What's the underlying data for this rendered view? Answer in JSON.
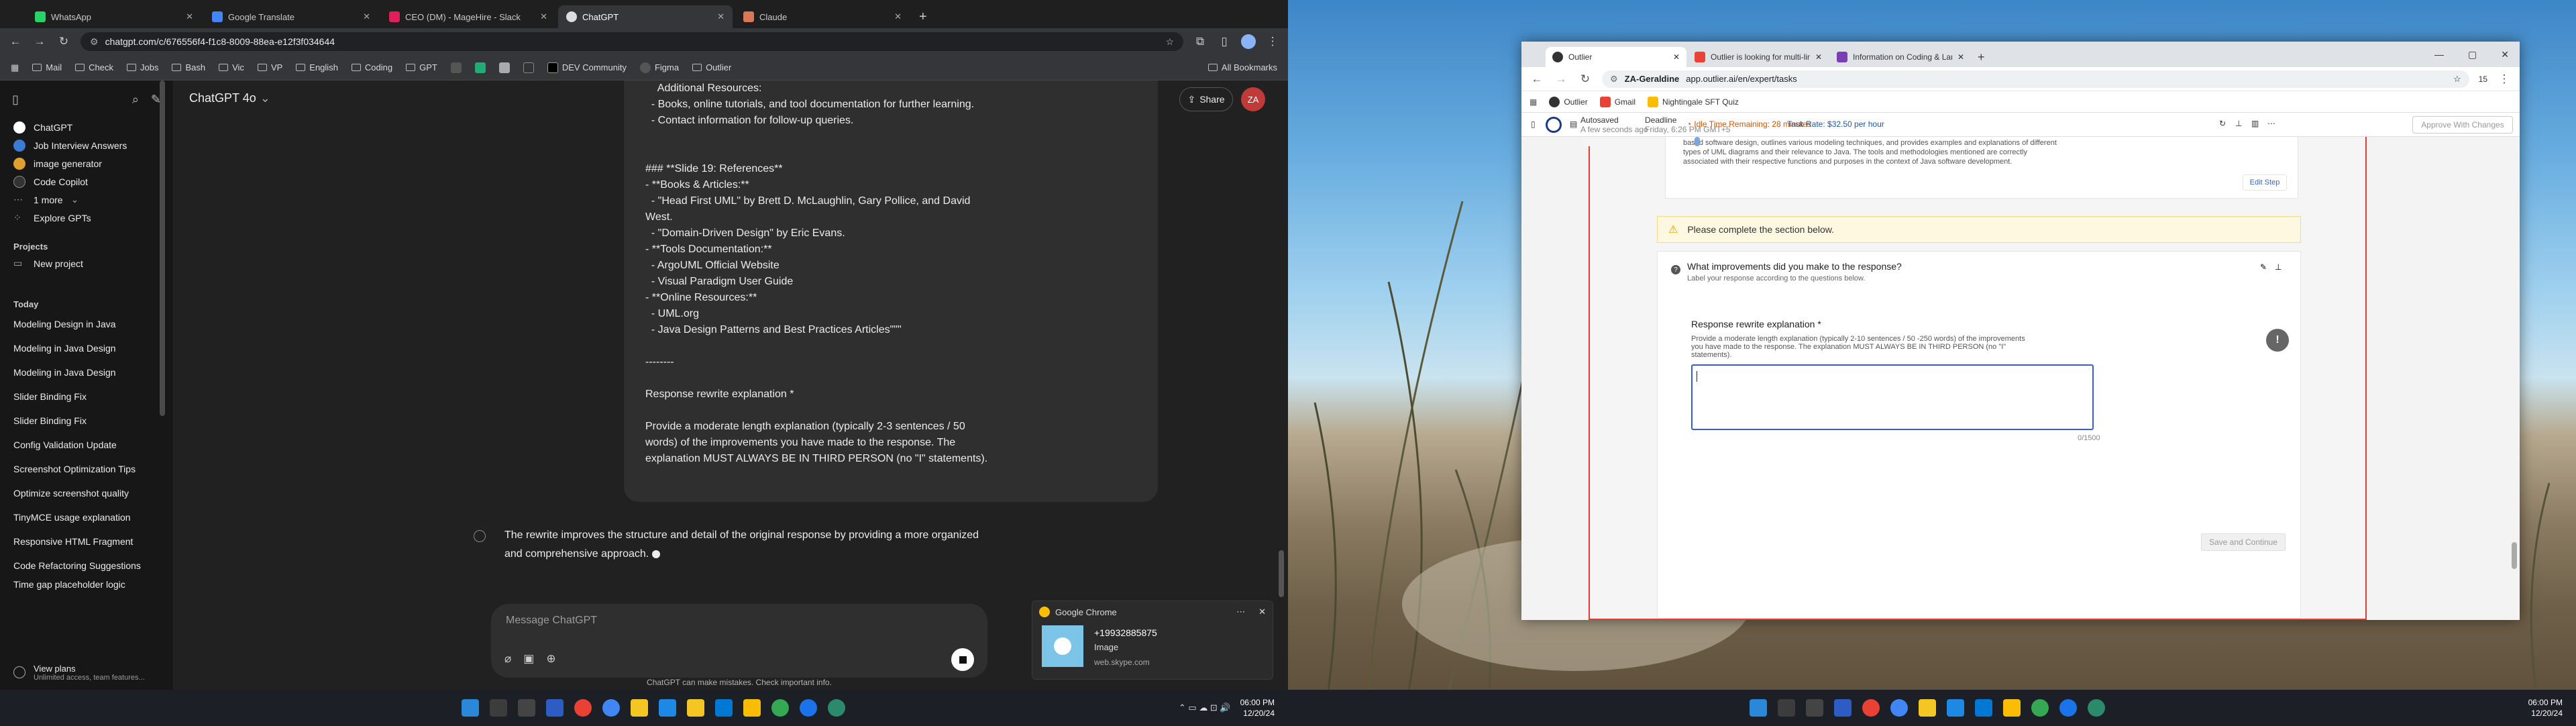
{
  "left_browser": {
    "tabs": [
      {
        "title": "WhatsApp",
        "color": "#25d366"
      },
      {
        "title": "Google Translate",
        "color": "#4285f4"
      },
      {
        "title": "CEO (DM) - MageHire - Slack",
        "color": "#e01e5a"
      },
      {
        "title": "ChatGPT",
        "color": "#dddddd"
      },
      {
        "title": "Claude",
        "color": "#d97757"
      }
    ],
    "url": "chatgpt.com/c/676556f4-f1c8-8009-88ea-e12f3f034644",
    "bookmarks": [
      "Mail",
      "Check",
      "Jobs",
      "Bash",
      "Vic",
      "VP",
      "English",
      "Coding",
      "GPT",
      "DEV Community",
      "Figma",
      "Outlier"
    ],
    "all_bookmarks": "All Bookmarks"
  },
  "sidebar": {
    "top_items": [
      {
        "label": "ChatGPT",
        "color": "#ffffff"
      },
      {
        "label": "Job Interview Answers",
        "color": "#3a7bd5"
      },
      {
        "label": "image generator",
        "color": "#e0a030"
      },
      {
        "label": "Code Copilot",
        "color": "#333333"
      },
      {
        "label": "1 more",
        "color": "#171717"
      },
      {
        "label": "Explore GPTs",
        "color": "#171717"
      }
    ],
    "projects_label": "Projects",
    "new_project": "New project",
    "today_label": "Today",
    "history": [
      "Modeling Design in Java",
      "Modeling in Java Design",
      "Modeling in Java Design",
      "Slider Binding Fix",
      "Slider Binding Fix",
      "Config Validation Update",
      "Screenshot Optimization Tips",
      "Optimize screenshot quality",
      "TinyMCE usage explanation",
      "Responsive HTML Fragment",
      "Code Refactoring Suggestions",
      "Time gap placeholder logic"
    ],
    "view_plans": "View plans",
    "view_plans_sub": "Unlimited access, team features..."
  },
  "chat": {
    "model": "ChatGPT 4o",
    "share": "Share",
    "avatar": "ZA",
    "message_lines": [
      "    Additional Resources:",
      "  - Books, online tutorials, and tool documentation for further learning.",
      "  - Contact information for follow-up queries.",
      "",
      "",
      "### **Slide 19: References**",
      "- **Books & Articles:**",
      "  - \"Head First UML\" by Brett D. McLaughlin, Gary Pollice, and David",
      "West.",
      "  - \"Domain-Driven Design\" by Eric Evans.",
      "- **Tools Documentation:**",
      "  - ArgoUML Official Website",
      "  - Visual Paradigm User Guide",
      "- **Online Resources:**",
      "  - UML.org",
      "  - Java Design Patterns and Best Practices Articles\"\"\"",
      "",
      "--------",
      "",
      "Response rewrite explanation *",
      "",
      "Provide a moderate length explanation (typically 2-3 sentences / 50",
      "words) of the improvements you have made to the response. The",
      "explanation MUST ALWAYS BE IN THIRD PERSON (no \"I\" statements)."
    ],
    "reply_line1": "The rewrite improves the structure and detail of the original response by providing a more organized",
    "reply_line2": "and comprehensive approach.",
    "input_placeholder": "Message ChatGPT",
    "footer": "ChatGPT can make mistakes. Check important info."
  },
  "notification": {
    "app": "Google Chrome",
    "phone": "+19932885875",
    "type": "Image",
    "source": "web.skype.com"
  },
  "right_browser": {
    "tabs": [
      {
        "title": "Outlier",
        "color": "#333333"
      },
      {
        "title": "Outlier is looking for multi-ling",
        "color": "#ea4335"
      },
      {
        "title": "Information on Coding & Lang",
        "color": "#7b3fb5"
      }
    ],
    "profile": "ZA-Geraldine",
    "url": "app.outlier.ai/en/expert/tasks",
    "ext_count": "15",
    "bookmarks": [
      "Outlier",
      "Gmail",
      "Nightingale SFT Quiz"
    ]
  },
  "outlier": {
    "autosaved": "Autosaved",
    "autosaved_time": "A few seconds ago",
    "deadline_label": "Deadline",
    "deadline": "Friday, 6:26 PM GMT+5",
    "idle_time": "Idle Time Remaining: 28 minutes",
    "task_rate": "Task Rate: $32.50 per hour",
    "approve": "Approve With Changes",
    "prev_text_lines": [
      "based software design, outlines various modeling techniques, and provides examples and explanations of different",
      "types of UML diagrams and their relevance to Java. The tools and methodologies mentioned are correctly",
      "associated with their respective functions and purposes in the context of Java software development."
    ],
    "edit_step": "Edit Step",
    "warning": "Please complete the section below.",
    "question": "What improvements did you make to the response?",
    "question_sub": "Label your response according to the questions below.",
    "field_label": "Response rewrite explanation *",
    "field_help_lines": [
      "Provide a moderate length explanation (typically 2-10 sentences / 50 -250 words) of the improvements",
      "you have made to the response. The explanation MUST ALWAYS BE IN THIRD PERSON (no \"I\"",
      "statements)."
    ],
    "char_count": "0/1500",
    "save_continue": "Save and Continue"
  },
  "taskbar": {
    "time": "06:00 PM",
    "date": "12/20/24"
  }
}
